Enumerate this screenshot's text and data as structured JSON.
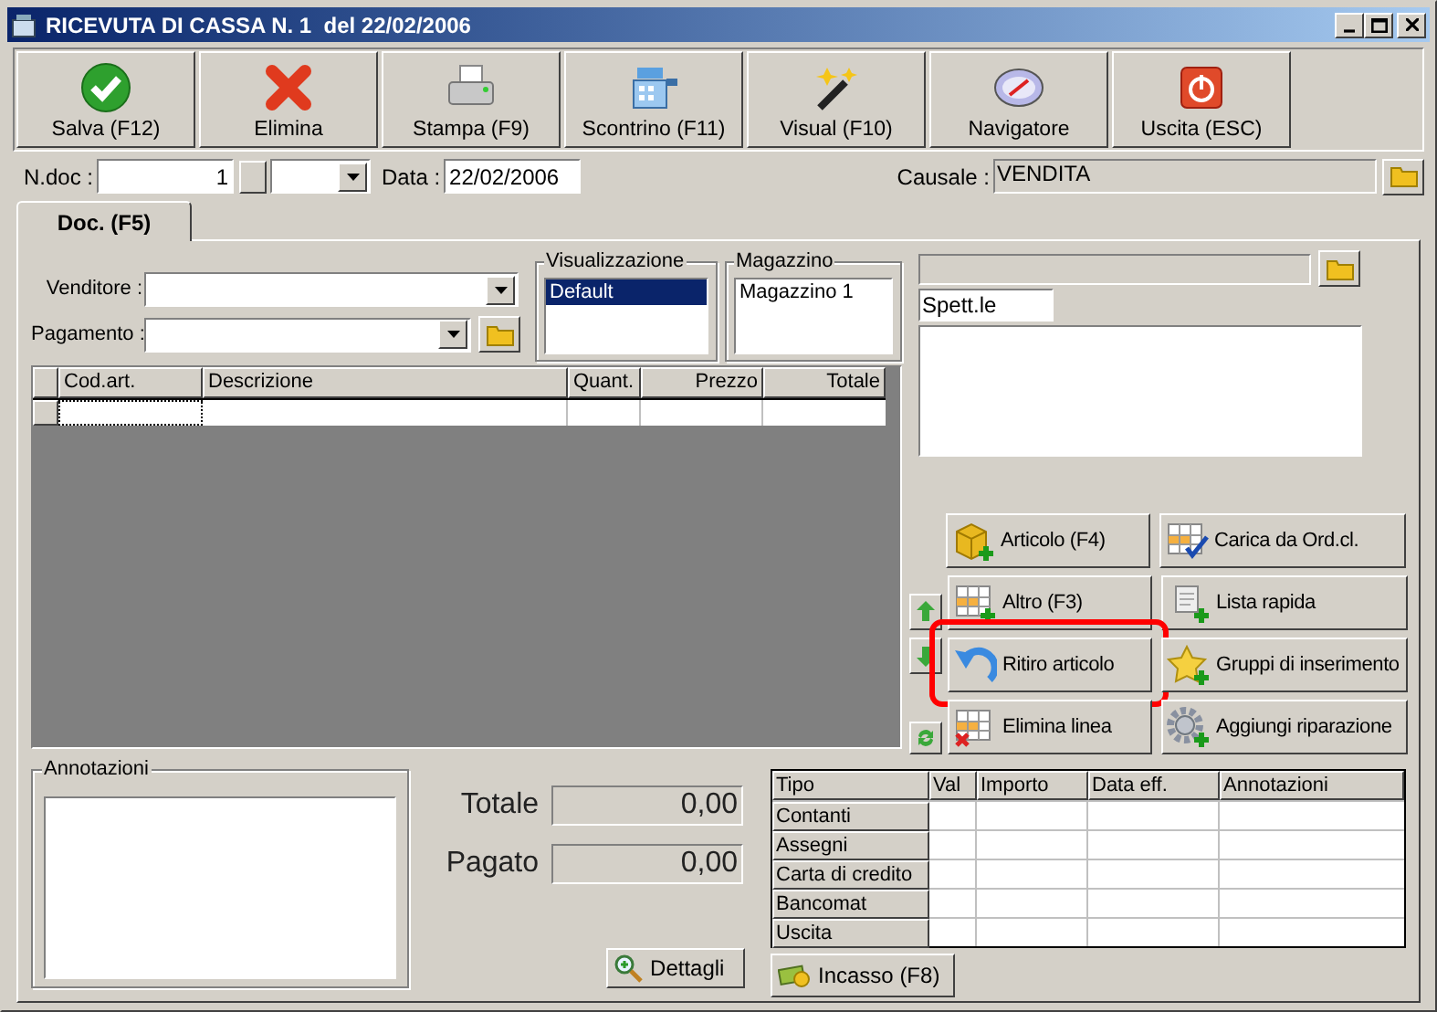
{
  "window": {
    "title": "RICEVUTA DI CASSA N. 1  del 22/02/2006"
  },
  "toolbar": [
    {
      "label": "Salva (F12)",
      "kind": "check"
    },
    {
      "label": "Elimina",
      "kind": "cross"
    },
    {
      "label": "Stampa (F9)",
      "kind": "printer"
    },
    {
      "label": "Scontrino (F11)",
      "kind": "register"
    },
    {
      "label": "Visual (F10)",
      "kind": "wand"
    },
    {
      "label": "Navigatore",
      "kind": "compass"
    },
    {
      "label": "Uscita (ESC)",
      "kind": "power"
    }
  ],
  "header": {
    "ndoc_label": "N.doc :",
    "ndoc_value": "1",
    "date_label": "Data :",
    "date_value": "22/02/2006",
    "causale_label": "Causale :",
    "causale_value": "VENDITA"
  },
  "tabs": [
    {
      "label": "Doc. (F5)",
      "selected": true
    }
  ],
  "form": {
    "venditore_label": "Venditore :",
    "pagamento_label": "Pagamento :",
    "visualizzazione": {
      "title": "Visualizzazione",
      "items": [
        {
          "label": "Default",
          "selected": true
        }
      ]
    },
    "magazzino": {
      "title": "Magazzino",
      "items": [
        {
          "label": "Magazzino 1",
          "selected": false
        }
      ]
    }
  },
  "grid": {
    "columns": [
      "Cod.art.",
      "Descrizione",
      "Quant.",
      "Prezzo",
      "Totale"
    ]
  },
  "customer": {
    "salutation": "Spett.le"
  },
  "actions": [
    {
      "label": "Articolo (F4)",
      "kind": "box",
      "highlighted": false
    },
    {
      "label": "Carica da Ord.cl.",
      "kind": "table-check",
      "highlighted": false
    },
    {
      "label": "Altro (F3)",
      "kind": "table-plus",
      "highlighted": false
    },
    {
      "label": "Lista rapida",
      "kind": "scroll",
      "highlighted": false
    },
    {
      "label": "Ritiro articolo",
      "kind": "undo",
      "highlighted": true
    },
    {
      "label": "Gruppi di inserimento",
      "kind": "star",
      "highlighted": false
    },
    {
      "label": "Elimina linea",
      "kind": "table-cross",
      "highlighted": false
    },
    {
      "label": "Aggiungi riparazione",
      "kind": "gear",
      "highlighted": false
    }
  ],
  "notes": {
    "title": "Annotazioni"
  },
  "totals": [
    {
      "label": "Totale",
      "value": "0,00"
    },
    {
      "label": "Pagato",
      "value": "0,00"
    }
  ],
  "details_button": "Dettagli",
  "payments": {
    "columns": [
      "Tipo",
      "Val",
      "Importo",
      "Data eff.",
      "Annotazioni"
    ],
    "rows": [
      "Contanti",
      "Assegni",
      "Carta di credito",
      "Bancomat",
      "Uscita"
    ]
  },
  "cash_button": "Incasso (F8)"
}
